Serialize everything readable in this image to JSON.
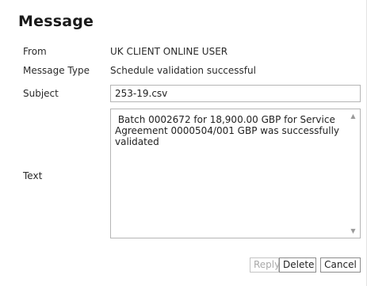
{
  "dialog": {
    "title": "Message"
  },
  "fields": {
    "from_label": "From",
    "from_value": "UK CLIENT ONLINE USER",
    "message_type_label": "Message Type",
    "message_type_value": "Schedule validation successful",
    "subject_label": "Subject",
    "subject_value": "253-19.csv",
    "text_label": "Text",
    "text_value": " Batch 0002672 for 18,900.00 GBP for Service\nAgreement 0000504/001 GBP was successfully\nvalidated"
  },
  "scrollbar": {
    "up_icon": "▲",
    "down_icon": "▼"
  },
  "buttons": {
    "reply_label": "Reply",
    "reply_enabled": false,
    "delete_label": "Delete",
    "cancel_label": "Cancel"
  }
}
